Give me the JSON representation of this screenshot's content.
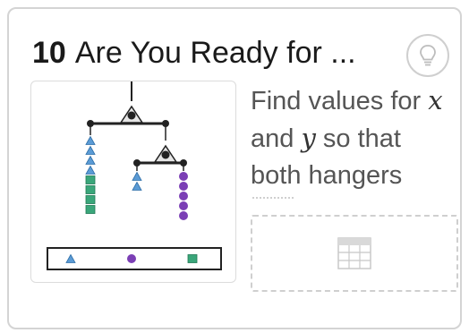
{
  "card": {
    "lesson_number": "10",
    "title": "Are You Ready for ...",
    "prompt_parts": [
      "Find values for ",
      "x",
      " and ",
      "y",
      " so that both hangers"
    ],
    "hint_icon": "lightbulb-icon",
    "table_icon": "table-icon"
  },
  "colors": {
    "triangle": "#5b9bd5",
    "circle": "#7b3fb5",
    "square": "#3aa67a",
    "border": "#d4d4d4",
    "text": "#555555"
  },
  "hanger_diagram": {
    "left_hanger": {
      "triangles": 4,
      "squares": 4
    },
    "right_hanger_left_side": {
      "triangles": 2
    },
    "right_hanger_right_side": {
      "circles": 5
    },
    "legend": [
      "triangle",
      "circle",
      "square"
    ]
  }
}
